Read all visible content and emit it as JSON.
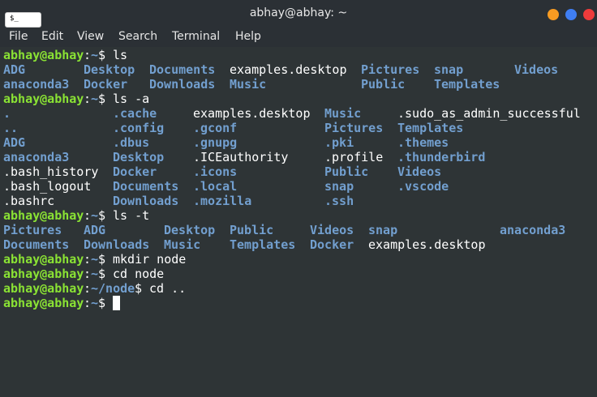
{
  "window": {
    "title": "abhay@abhay: ~",
    "icon_label": "$_",
    "buttons": [
      "minimize",
      "maximize",
      "close"
    ],
    "colors": {
      "minimize": "#f89b22",
      "maximize": "#3f7ef3",
      "close": "#ee3b3b",
      "background": "#2e3436",
      "user_host": "#8ae234",
      "directory": "#729fcf"
    }
  },
  "menu": {
    "items": [
      "File",
      "Edit",
      "View",
      "Search",
      "Terminal",
      "Help"
    ]
  },
  "prompt": {
    "user_host": "abhay@abhay",
    "colon": ":",
    "home_path": "~",
    "node_path": "~/node",
    "symbol": "$ "
  },
  "terminal": {
    "commands": [
      "ls",
      "ls -a",
      "ls -t",
      "mkdir node",
      "cd node",
      "cd .."
    ],
    "ls_output": [
      [
        "ADG",
        "Desktop",
        "Documents",
        "examples.desktop",
        "Pictures",
        "snap",
        "Videos"
      ],
      [
        "anaconda3",
        "Docker",
        "Downloads",
        "Music",
        "Public",
        "Templates"
      ]
    ],
    "ls_a_output": [
      [
        ".",
        ".cache",
        "examples.desktop",
        "Music",
        ".sudo_as_admin_successful"
      ],
      [
        "..",
        ".config",
        ".gconf",
        "Pictures",
        "Templates"
      ],
      [
        "ADG",
        ".dbus",
        ".gnupg",
        ".pki",
        ".themes"
      ],
      [
        "anaconda3",
        "Desktop",
        ".ICEauthority",
        ".profile",
        ".thunderbird"
      ],
      [
        ".bash_history",
        "Docker",
        ".icons",
        "Public",
        "Videos"
      ],
      [
        ".bash_logout",
        "Documents",
        ".local",
        "snap",
        ".vscode"
      ],
      [
        ".bashrc",
        "Downloads",
        ".mozilla",
        ".ssh"
      ]
    ],
    "ls_t_output": [
      [
        "Pictures",
        "ADG",
        "Desktop",
        "Public",
        "Videos",
        "snap",
        "anaconda3"
      ],
      [
        "Documents",
        "Downloads",
        "Music",
        "Templates",
        "Docker",
        "examples.desktop"
      ]
    ]
  }
}
